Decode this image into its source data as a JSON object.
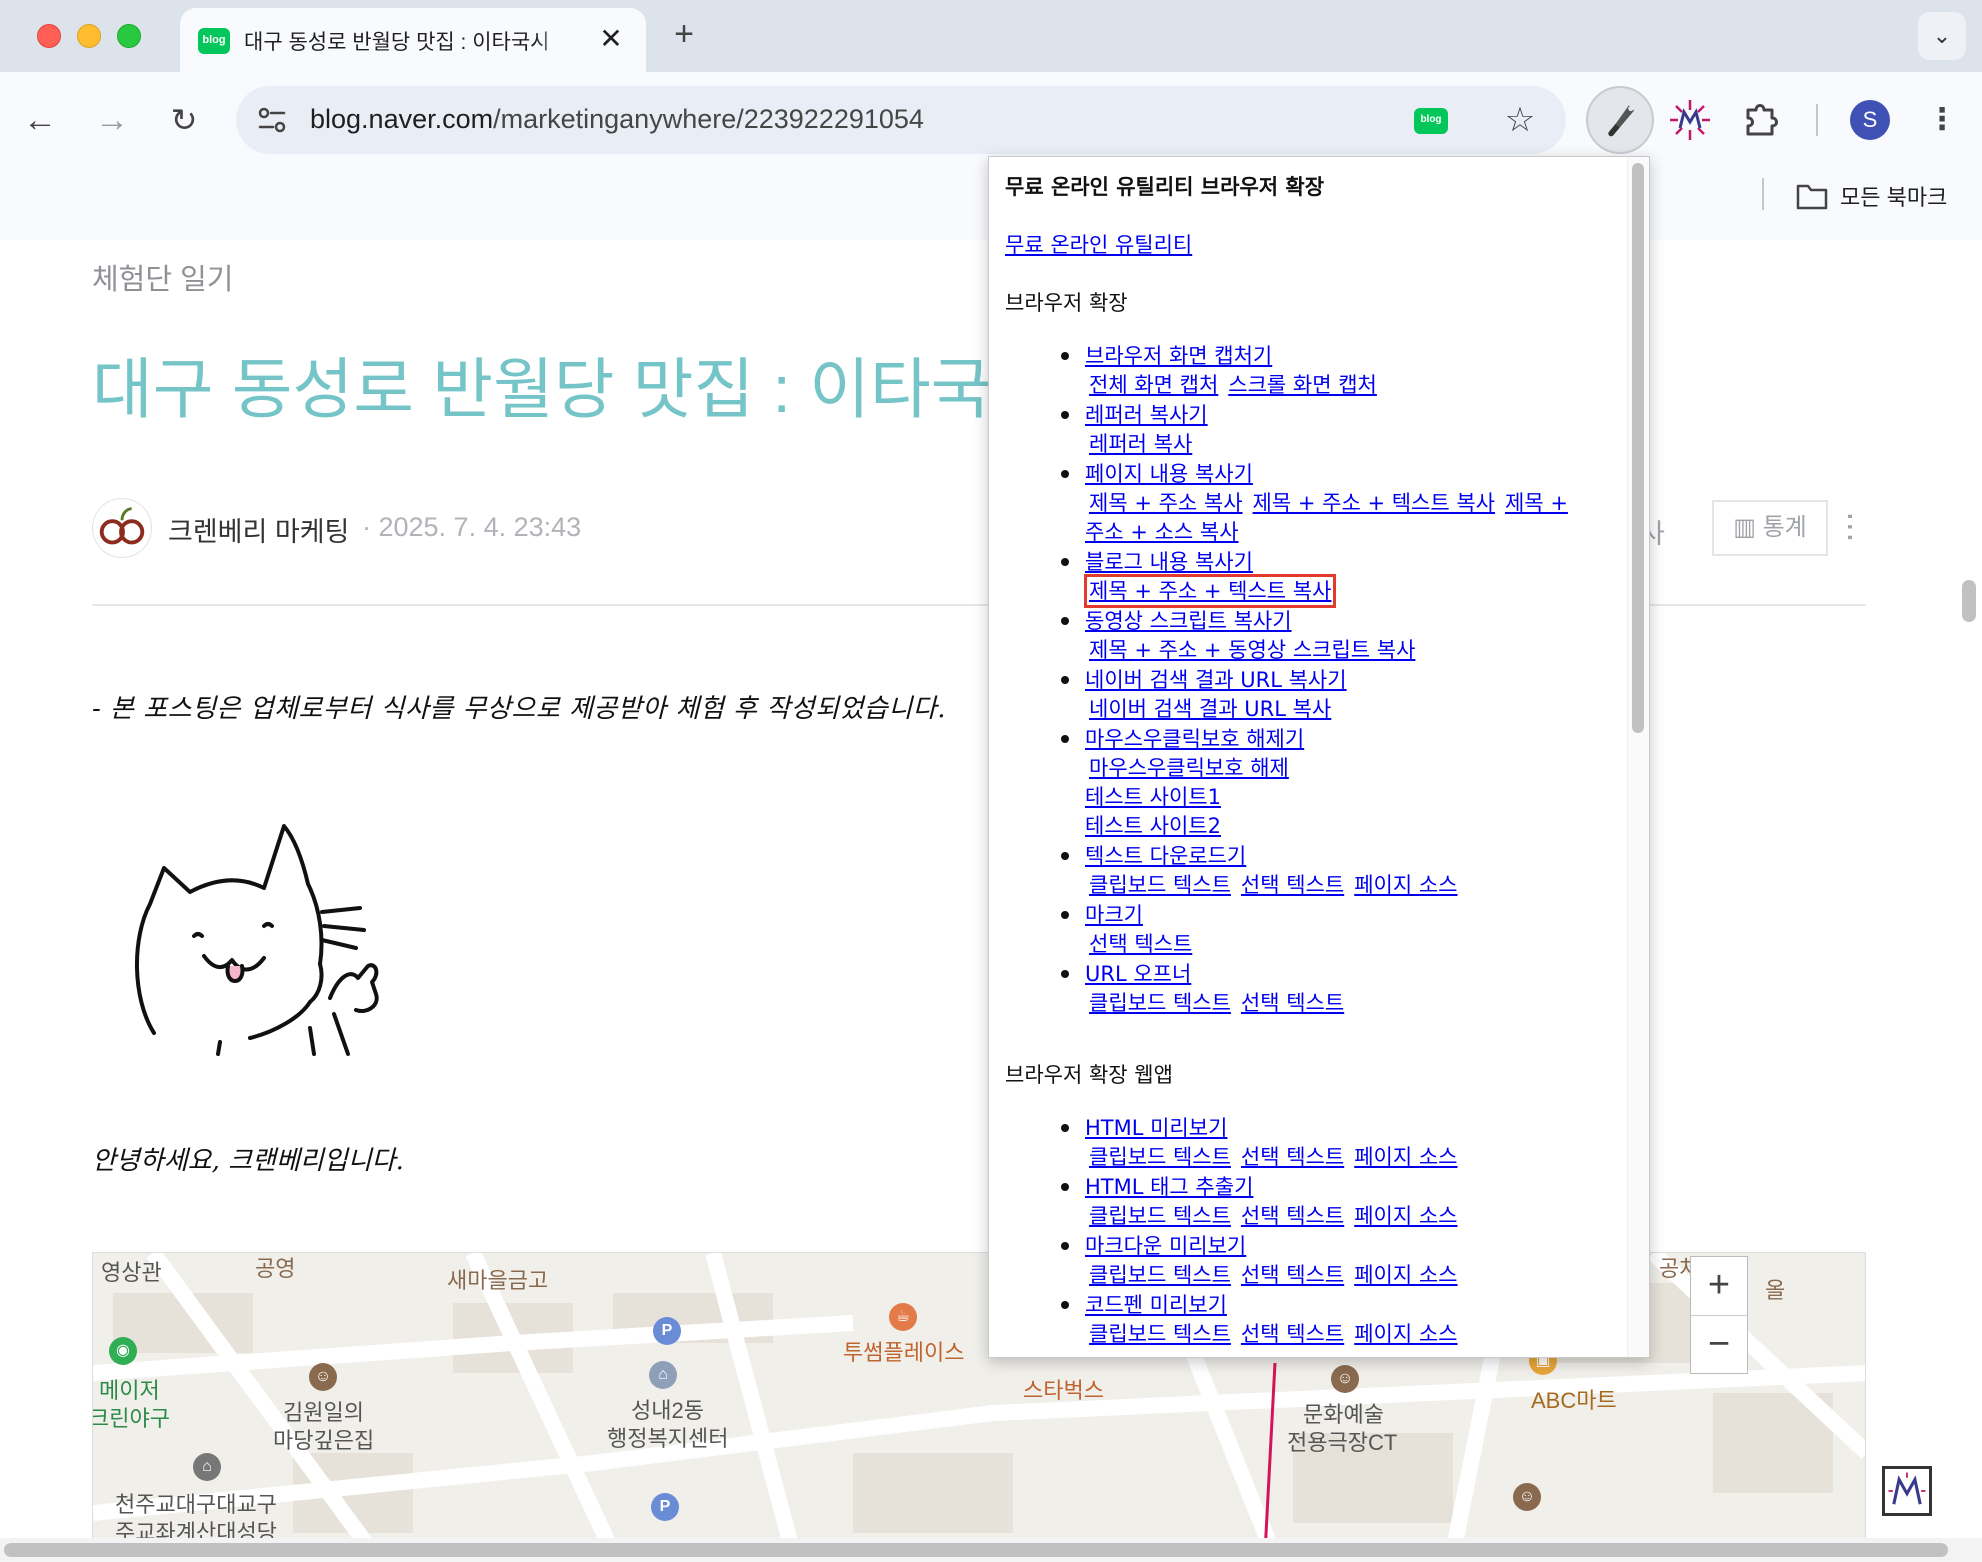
{
  "browser": {
    "tab_title": "대구 동성로 반월당 맛집 : 이타국시",
    "tab_favicon_text": "blog",
    "url_host": "blog.naver.com",
    "url_path": "/marketinganywhere/223922291054",
    "omnibox_badge_text": "blog",
    "profile_initial": "S",
    "bookmarks_all_label": "모든 북마크"
  },
  "post": {
    "category": "체험단 일기",
    "title": "대구 동성로 반월당 맛집 : 이타국시",
    "author": "크렌베리 마케팅",
    "date": "· 2025. 7. 4. 23:43",
    "copy_fragment": "사",
    "stats_label": "통계",
    "notice": "- 본 포스팅은 업체로부터 식사를 무상으로 제공받아 체험 후 작성되었습니다.",
    "greeting": "안녕하세요, 크랜베리입니다."
  },
  "map": {
    "labels": [
      "영상관",
      "공영",
      "새마을금고",
      "메이저",
      "크린야구",
      "김원일의",
      "마당깊은집",
      "성내2동",
      "행정복지센터",
      "투썸플레이스",
      "스타벅스",
      "문화예술",
      "전용극장CT",
      "ABC마트",
      "공차",
      "올",
      "천주교대구대교구",
      "주교좌계산대성당"
    ],
    "pin_glyph": "P",
    "zoom_in": "+",
    "zoom_out": "−"
  },
  "popup": {
    "title": "무료 온라인 유틸리티 브라우저 확장",
    "main_link": "무료 온라인 유틸리티",
    "section_extensions": "브라우저 확장",
    "section_webapps": "브라우저 확장 웹앱",
    "extensions": [
      {
        "name": "브라우저 화면 캡처기",
        "subs": [
          "전체 화면 캡처",
          "스크롤 화면 캡처"
        ]
      },
      {
        "name": "레퍼러 복사기",
        "subs": [
          "레퍼러 복사"
        ]
      },
      {
        "name": "페이지 내용 복사기",
        "subs": [
          "제목 + 주소 복사",
          "제목 + 주소 + 텍스트 복사",
          "제목 + 주소 + 소스 복사"
        ]
      },
      {
        "name": "블로그 내용 복사기",
        "subs": [
          "제목 + 주소 + 텍스트 복사"
        ]
      },
      {
        "name": "동영상 스크립트 복사기",
        "subs": [
          "제목 + 주소 + 동영상 스크립트 복사"
        ]
      },
      {
        "name": "네이버 검색 결과 URL 복사기",
        "subs": [
          "네이버 검색 결과 URL 복사"
        ]
      },
      {
        "name": "마우스우클릭보호 해제기",
        "subs": [
          "마우스우클릭보호 해제"
        ],
        "extra_links": [
          "테스트 사이트1",
          "테스트 사이트2"
        ]
      },
      {
        "name": "텍스트 다운로드기",
        "subs": [
          "클립보드 텍스트",
          "선택 텍스트",
          "페이지 소스"
        ]
      },
      {
        "name": "마크기",
        "subs": [
          "선택 텍스트"
        ]
      },
      {
        "name": "URL 오프너",
        "subs": [
          "클립보드 텍스트",
          "선택 텍스트"
        ]
      }
    ],
    "webapps": [
      {
        "name": "HTML 미리보기",
        "subs": [
          "클립보드 텍스트",
          "선택 텍스트",
          "페이지 소스"
        ]
      },
      {
        "name": "HTML 태그 추출기",
        "subs": [
          "클립보드 텍스트",
          "선택 텍스트",
          "페이지 소스"
        ]
      },
      {
        "name": "마크다운 미리보기",
        "subs": [
          "클립보드 텍스트",
          "선택 텍스트",
          "페이지 소스"
        ]
      },
      {
        "name": "코드펜 미리보기",
        "subs": [
          "클립보드 텍스트",
          "선택 텍스트",
          "페이지 소스"
        ]
      }
    ]
  },
  "colors": {
    "title_teal": "#75c4c7",
    "link_blue": "#0000ee",
    "highlight_red": "#e23b2e",
    "naver_green": "#03c75a"
  }
}
